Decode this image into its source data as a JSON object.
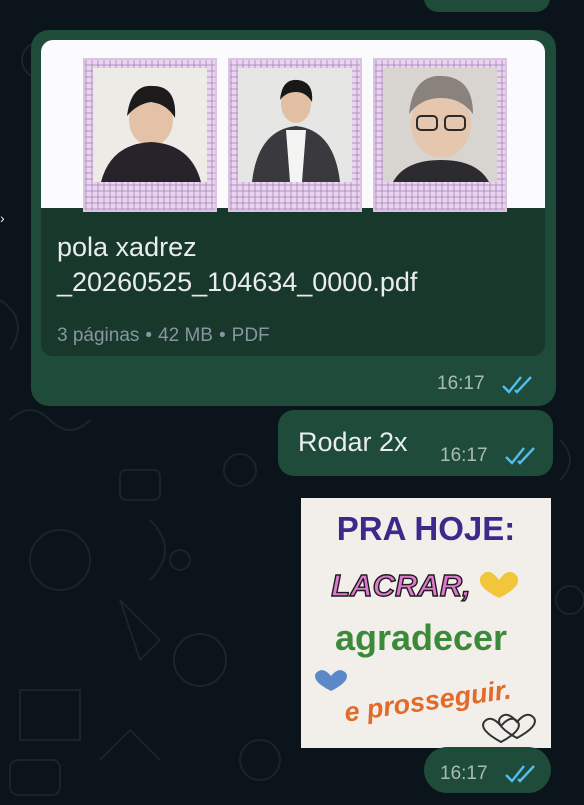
{
  "chat": {
    "messages": [
      {
        "type": "document",
        "file_name": "pola xadrez _20260525_104634_0000.pdf",
        "pages": "3 páginas",
        "size": "42 MB",
        "file_type": "PDF",
        "separator": "•",
        "time": "16:17",
        "status": "read",
        "preview_icon": "polaroid-photos-preview"
      },
      {
        "type": "text",
        "text": "Rodar 2x",
        "time": "16:17",
        "status": "read"
      },
      {
        "type": "sticker",
        "sticker_lines": [
          "PRA HOJE:",
          "LACRAR,",
          "agradecer",
          "e prosseguir."
        ],
        "time": "16:17",
        "status": "read"
      }
    ]
  },
  "colors": {
    "background": "#0b141a",
    "outgoing_bubble": "#1f4b3a",
    "read_ticks": "#53bdeb",
    "text_primary": "#e9edef",
    "text_secondary": "#8696a0"
  },
  "icons": {
    "read_receipt": "double-check-icon"
  }
}
